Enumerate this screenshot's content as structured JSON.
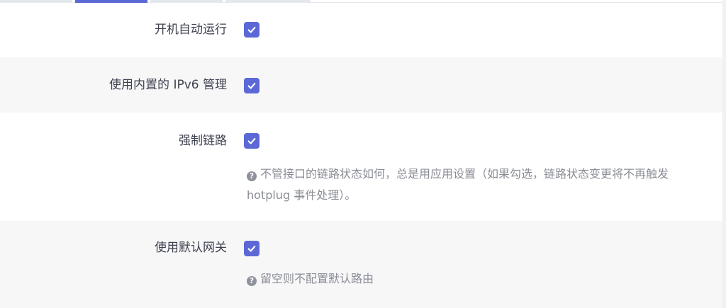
{
  "fields": [
    {
      "label": "开机自动运行",
      "checked": true,
      "help": ""
    },
    {
      "label": "使用内置的 IPv6 管理",
      "checked": true,
      "help": ""
    },
    {
      "label": "强制链路",
      "checked": true,
      "help": "不管接口的链路状态如何，总是用应用设置（如果勾选，链路状态变更将不再触发 hotplug 事件处理）。"
    },
    {
      "label": "使用默认网关",
      "checked": true,
      "help": "留空则不配置默认路由"
    }
  ],
  "icons": {
    "check": "check-icon",
    "help": "question-circle-icon"
  },
  "colors": {
    "accent": "#5b68d6",
    "row_alt": "#f7f7f8",
    "help_text": "#8b8d96"
  }
}
